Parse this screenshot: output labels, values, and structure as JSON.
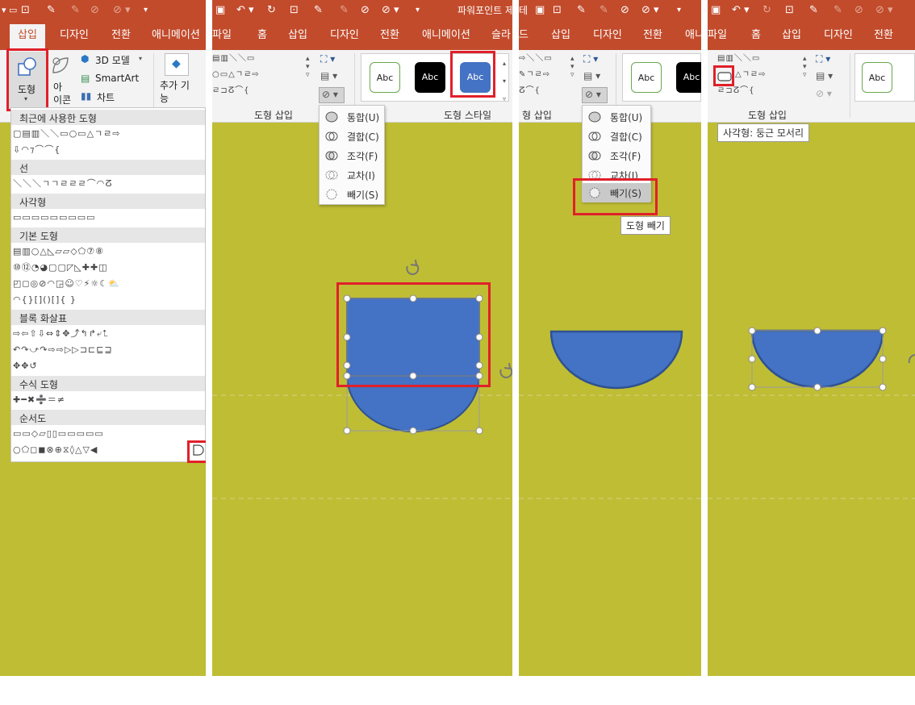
{
  "colors": {
    "titlebar": "#c24b2c",
    "ribbon": "#f3f3f3",
    "slide_bg": "#bfbd34",
    "shape_fill": "#4472c4",
    "shape_line": "#2f528f",
    "highlight": "#e0202a"
  },
  "panel1": {
    "active_tab": "삽입",
    "tabs": [
      "디자인",
      "전환",
      "애니메이션"
    ],
    "ribbon": {
      "shapes": "도형",
      "icons": "아\n이콘",
      "model3d": "3D 모델",
      "smartart": "SmartArt",
      "chart": "차트",
      "addins": "추가 기\n능"
    },
    "gallery": {
      "sections": [
        "최근에 사용한 도형",
        "선",
        "사각형",
        "기본 도형",
        "블록 화살표",
        "수식 도형",
        "순서도"
      ],
      "rows": {
        "recent1": "▢▤▥＼＼▭○▭△ㄱㄹ⇨",
        "recent2": "⇩◠⁊⌒⌒{",
        "lines": "＼＼＼ㄱㄱㄹㄹㄹ⌒◠ⵒ",
        "rect": "▭▭▭▭▭▭▭▭▭",
        "basic1": "▤▥○△◺▱▱◇⬠⑦⑧",
        "basic2": "⑩⑫◔◕▢▢◸◺✚✚◫",
        "basic3": "◰◻◎⊘◠◲☺♡⚡☼☾⛅",
        "basic4": "◠{}[]()[]{ }",
        "arrows1": "⇨⇦⇧⇩⇔⇕✥⤴↰↱⤶⮤",
        "arrows2": "↶↷⤻↷⇨⇨▷▷⊐⊏⊑⊒",
        "arrows3": "✥✥↺",
        "math": "✚━✖➗＝≠",
        "flow1": "▭▭◇▱▯▯▭▭▭▭▭",
        "flow2": "○⬠◻◼⊗⊕⧖◊△▽◀",
        "flow3": "○○◪◠"
      }
    }
  },
  "panel2": {
    "title_fragment": "파워포인트 제",
    "tabs": [
      "파일",
      "홈",
      "삽입",
      "디자인",
      "전환",
      "애니메이션",
      "슬라"
    ],
    "group_insert": "도형 삽입",
    "group_style": "도형 스타일",
    "style_sample": "Abc",
    "shape_grid": {
      "r1": "▤▥＼＼▭",
      "r2": "○▭△ㄱㄹ⇨",
      "r3": "ㄹ⊐ⵒ⌒{"
    },
    "menu": [
      "통합(U)",
      "결합(C)",
      "조각(F)",
      "교차(I)",
      "빼기(S)"
    ]
  },
  "panel3": {
    "tabs": [
      "드",
      "삽입",
      "디자인",
      "전환",
      "애니"
    ],
    "group_insert": "형 삽입",
    "menu": [
      "통합(U)",
      "결합(C)",
      "조각(F)",
      "교차(I)",
      "빼기(S)"
    ],
    "tooltip": "도형 빼기",
    "style_sample": "Abc"
  },
  "panel4": {
    "tabs": [
      "파일",
      "홈",
      "삽입",
      "디자인",
      "전환"
    ],
    "group_insert": "도형 삽입",
    "tooltip": "사각형: 둥근 모서리",
    "style_sample": "Abc"
  }
}
